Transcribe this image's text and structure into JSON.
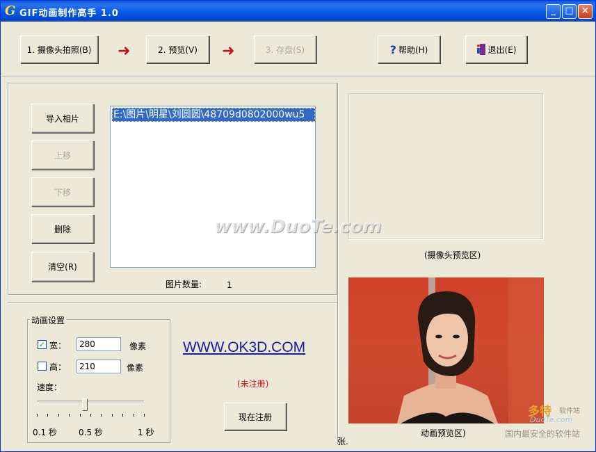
{
  "window": {
    "logo_letter": "G",
    "title": "GIF动画制作高手 1.0",
    "controls": {
      "minimize": "_",
      "maximize": "□",
      "close": "×"
    }
  },
  "toolbar": {
    "step1_label": "1. 摄像头拍照(B)",
    "step2_label": "2. 预览(V)",
    "step3_label": "3. 存盘(S)",
    "arrow_glyph": "➜",
    "help_label": "帮助(H)",
    "exit_label": "退出(E)",
    "help_icon": "question-icon",
    "exit_icon": "exit-door-icon"
  },
  "photo_panel": {
    "import_label": "导入相片",
    "move_up_label": "上移",
    "move_down_label": "下移",
    "delete_label": "删除",
    "clear_label": "清空(R)",
    "files": [
      "E:\\图片\\明星\\刘圆圆\\48709d0802000wu5"
    ],
    "count_label": "图片数量:",
    "count_value": "1"
  },
  "preview": {
    "camera_label": "(摄像头预览区)",
    "animation_label": "动画预览区)"
  },
  "anim_settings": {
    "legend": "动画设置",
    "width_label": "宽：",
    "width_checked": true,
    "width_value": "280",
    "width_unit": "像素",
    "height_label": "高：",
    "height_checked": false,
    "height_value": "210",
    "height_unit": "像素",
    "speed_label": "速度：",
    "speed_min": "0.1 秒",
    "speed_mid": "0.5 秒",
    "speed_max": "1 秒",
    "speed_fraction": 0.45
  },
  "register": {
    "website": "WWW.OK3D.COM",
    "status": "(未注册)",
    "register_label": "现在注册",
    "status_tail": "张."
  },
  "watermarks": {
    "center": "www.DuoTe.com",
    "corner_brand": "多特",
    "corner_brand_sub": "软件站",
    "corner_url": "DuoTe.com",
    "corner_slogan": "国内最安全的软件站"
  }
}
